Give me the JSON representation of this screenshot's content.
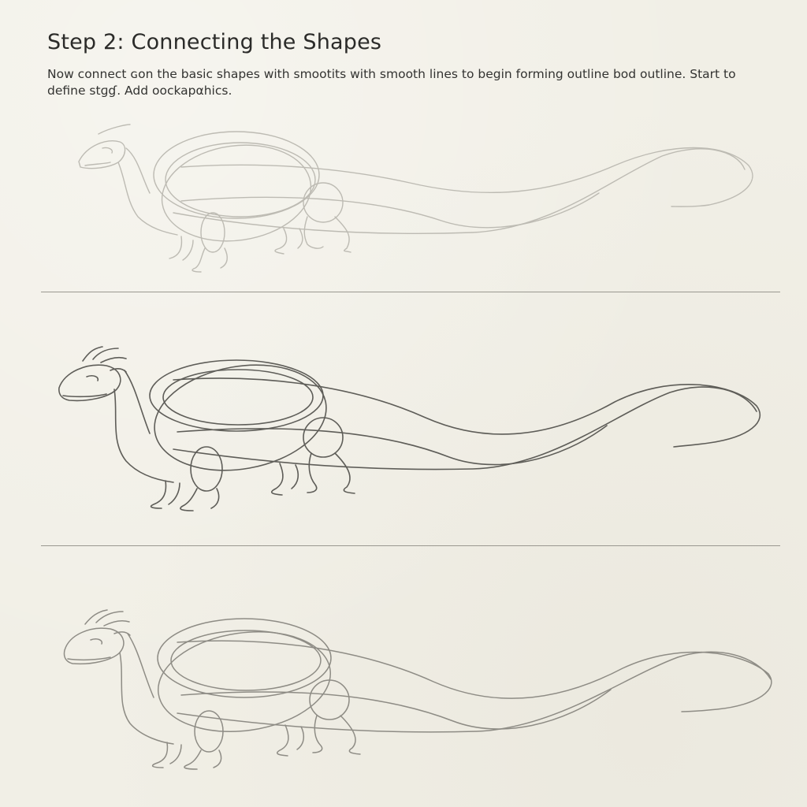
{
  "page": {
    "title": "Step 2: Connecting the Shapes",
    "instructions": "Now connect ɢon the basic shapes with smootits with smooth lines to begin forming outline bod outline. Start to define stɡɠ. Add οockapαhics."
  },
  "panels": [
    {
      "stage": "light-construction",
      "stroke_color": "#b9b7af"
    },
    {
      "stage": "defined-outline",
      "stroke_color": "#5d5c57"
    },
    {
      "stage": "refined-sketch",
      "stroke_color": "#8f8d86"
    }
  ],
  "colors": {
    "paper": "#f1efe6",
    "text": "#2e2e2c",
    "divider": "#9a9890"
  }
}
